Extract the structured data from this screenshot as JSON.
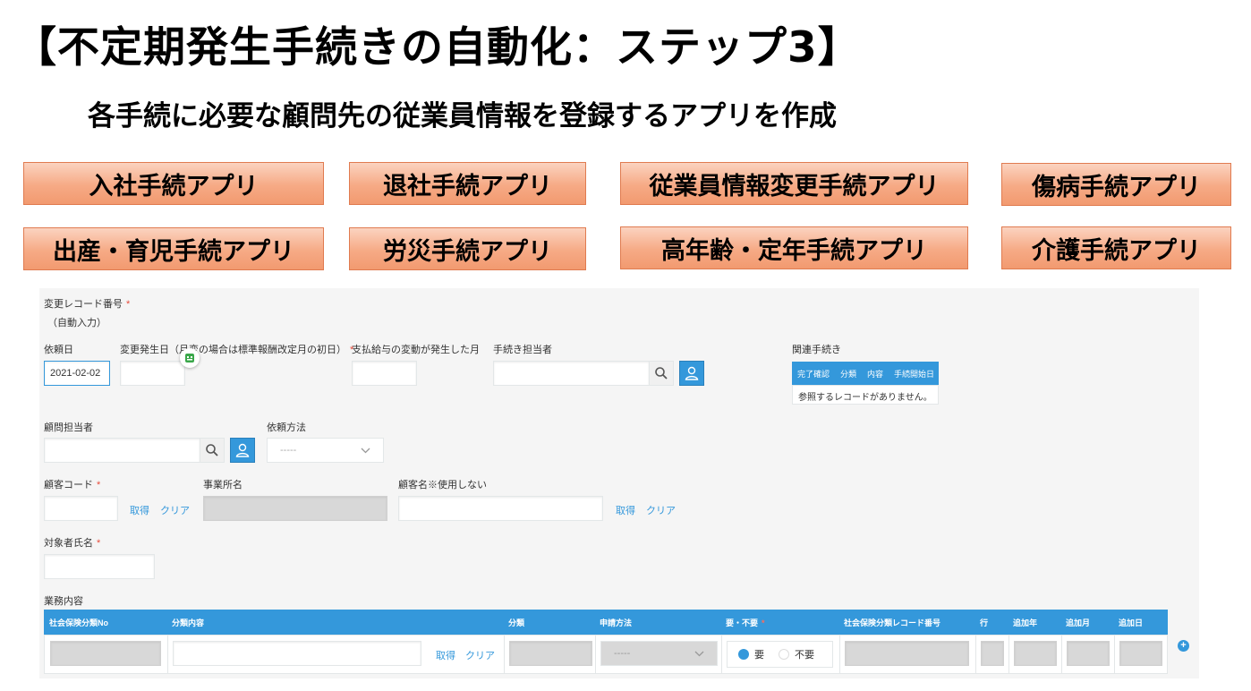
{
  "slide": {
    "title": "【不定期発生手続きの自動化：ステップ3】",
    "subtitle": "各手続に必要な顧問先の従業員情報を登録するアプリを作成"
  },
  "apps": [
    {
      "label": "入社手続アプリ"
    },
    {
      "label": "退社手続アプリ"
    },
    {
      "label": "従業員情報変更手続アプリ"
    },
    {
      "label": "傷病手続アプリ"
    },
    {
      "label": "出産・育児手続アプリ"
    },
    {
      "label": "労災手続アプリ"
    },
    {
      "label": "高年齢・定年手続アプリ"
    },
    {
      "label": "介護手続アプリ"
    }
  ],
  "form": {
    "record_no_label": "変更レコード番号",
    "record_no_value": "（自動入力）",
    "request_date_label": "依頼日",
    "request_date_value": "2021-02-02",
    "change_date_label": "変更発生日（月変の場合は標準報酬改定月の初日）",
    "pay_change_label": "支払給与の変動が発生した月",
    "handler_label": "手続き担当者",
    "related_label": "関連手続き",
    "related_columns": [
      "完了確認",
      "分類",
      "内容",
      "手続開始日"
    ],
    "related_empty": "参照するレコードがありません。",
    "advisor_label": "顧問担当者",
    "request_method_label": "依頼方法",
    "request_method_value": "-----",
    "customer_code_label": "顧客コード",
    "office_name_label": "事業所名",
    "customer_name_label": "顧客名※使用しない",
    "get_link": "取得",
    "clear_link": "クリア",
    "target_name_label": "対象者氏名",
    "business_label": "業務内容",
    "required_mark": "*",
    "table": {
      "columns": [
        "社会保険分類No",
        "分類内容",
        "分類",
        "申請方法",
        "要・不要",
        "社会保険分類レコード番号",
        "行",
        "追加年",
        "追加月",
        "追加日"
      ],
      "method_value": "-----",
      "radio_yes": "要",
      "radio_no": "不要"
    }
  },
  "colors": {
    "accent": "#3498db",
    "required": "#e74c3c",
    "tag_border": "#e07b50"
  }
}
